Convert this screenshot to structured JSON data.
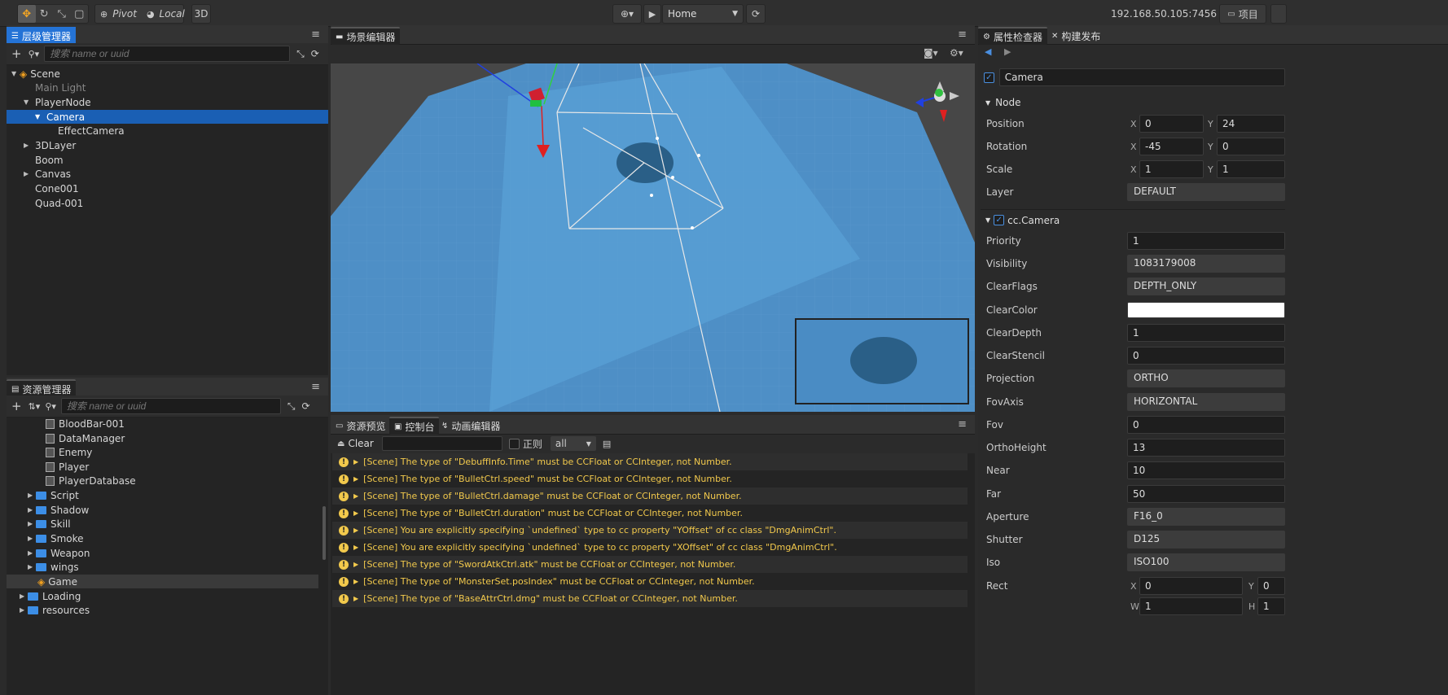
{
  "toolbar": {
    "pivot": "Pivot",
    "local": "Local",
    "mode3d": "3D",
    "scene_select": "Home",
    "ip": "192.168.50.105:7456",
    "project": "项目"
  },
  "hierarchy": {
    "title": "层级管理器",
    "search_placeholder": "搜索 name or uuid",
    "items": [
      {
        "label": "Scene"
      },
      {
        "label": "Main Light"
      },
      {
        "label": "PlayerNode"
      },
      {
        "label": "Camera"
      },
      {
        "label": "EffectCamera"
      },
      {
        "label": "3DLayer"
      },
      {
        "label": "Boom"
      },
      {
        "label": "Canvas"
      },
      {
        "label": "Cone001"
      },
      {
        "label": "Quad-001"
      }
    ]
  },
  "assets": {
    "title": "资源管理器",
    "search_placeholder": "搜索 name or uuid",
    "items": [
      {
        "label": "BloodBar-001"
      },
      {
        "label": "DataManager"
      },
      {
        "label": "Enemy"
      },
      {
        "label": "Player"
      },
      {
        "label": "PlayerDatabase"
      },
      {
        "label": "Script"
      },
      {
        "label": "Shadow"
      },
      {
        "label": "Skill"
      },
      {
        "label": "Smoke"
      },
      {
        "label": "Weapon"
      },
      {
        "label": "wings"
      },
      {
        "label": "Game"
      },
      {
        "label": "Loading"
      },
      {
        "label": "resources"
      }
    ]
  },
  "scene_editor": {
    "title": "场景编辑器"
  },
  "console": {
    "tabs": [
      "资源预览",
      "控制台",
      "动画编辑器"
    ],
    "clear": "Clear",
    "regex": "正则",
    "filter": "all",
    "logs": [
      "[Scene] The type of \"DebuffInfo.Time\" must be CCFloat or CCInteger, not Number.",
      "[Scene] The type of \"BulletCtrl.speed\" must be CCFloat or CCInteger, not Number.",
      "[Scene] The type of \"BulletCtrl.damage\" must be CCFloat or CCInteger, not Number.",
      "[Scene] The type of \"BulletCtrl.duration\" must be CCFloat or CCInteger, not Number.",
      "[Scene] You are explicitly specifying `undefined` type to cc property \"YOffset\" of cc class \"DmgAnimCtrl\".",
      "[Scene] You are explicitly specifying `undefined` type to cc property \"XOffset\" of cc class \"DmgAnimCtrl\".",
      "[Scene] The type of \"SwordAtkCtrl.atk\" must be CCFloat or CCInteger, not Number.",
      "[Scene] The type of \"MonsterSet.posIndex\" must be CCFloat or CCInteger, not Number.",
      "[Scene] The type of \"BaseAttrCtrl.dmg\" must be CCFloat or CCInteger, not Number."
    ]
  },
  "inspector": {
    "tabs": [
      "属性检查器",
      "构建发布"
    ],
    "node_name": "Camera",
    "node_section": "Node",
    "position": {
      "label": "Position",
      "x": "0",
      "y": "24"
    },
    "rotation": {
      "label": "Rotation",
      "x": "-45",
      "y": "0"
    },
    "scale": {
      "label": "Scale",
      "x": "1",
      "y": "1"
    },
    "layer": {
      "label": "Layer",
      "value": "DEFAULT"
    },
    "camera_section": "cc.Camera",
    "props": [
      {
        "label": "Priority",
        "value": "1",
        "kind": "input"
      },
      {
        "label": "Visibility",
        "value": "1083179008",
        "kind": "select"
      },
      {
        "label": "ClearFlags",
        "value": "DEPTH_ONLY",
        "kind": "select"
      },
      {
        "label": "ClearColor",
        "value": "",
        "kind": "color"
      },
      {
        "label": "ClearDepth",
        "value": "1",
        "kind": "input"
      },
      {
        "label": "ClearStencil",
        "value": "0",
        "kind": "input"
      },
      {
        "label": "Projection",
        "value": "ORTHO",
        "kind": "select"
      },
      {
        "label": "FovAxis",
        "value": "HORIZONTAL",
        "kind": "select"
      },
      {
        "label": "Fov",
        "value": "0",
        "kind": "input"
      },
      {
        "label": "OrthoHeight",
        "value": "13",
        "kind": "input"
      },
      {
        "label": "Near",
        "value": "10",
        "kind": "input"
      },
      {
        "label": "Far",
        "value": "50",
        "kind": "input"
      },
      {
        "label": "Aperture",
        "value": "F16_0",
        "kind": "select"
      },
      {
        "label": "Shutter",
        "value": "D125",
        "kind": "select"
      },
      {
        "label": "Iso",
        "value": "ISO100",
        "kind": "select"
      }
    ],
    "rect": {
      "label": "Rect",
      "x": "0",
      "y": "0",
      "w": "1",
      "h": "1"
    },
    "axis_labels": {
      "x": "X",
      "y": "Y",
      "w": "W",
      "h": "H"
    }
  },
  "colors": {
    "accent": "#2473d6",
    "warning": "#f2c94c",
    "folder": "#3c8ee6",
    "floor": "#4a90c8"
  }
}
